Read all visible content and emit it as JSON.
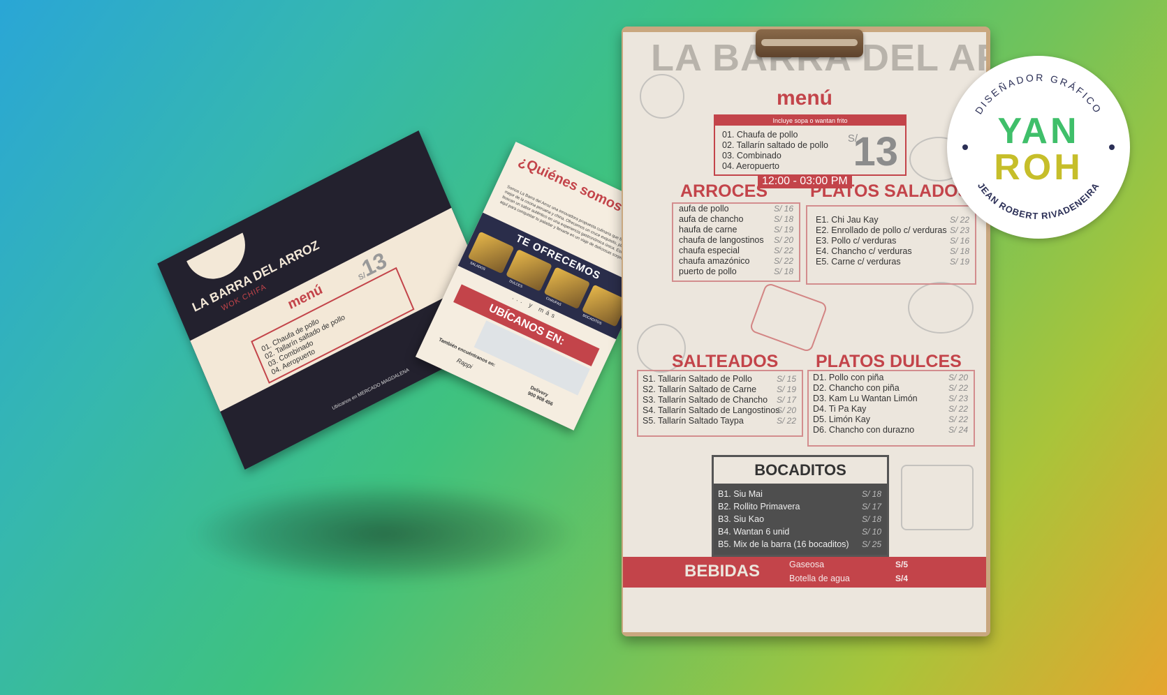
{
  "badge": {
    "top_text": "DISEÑADOR GRÁFICO",
    "bottom_text": "JEAN ROBERT RIVADENEIRA",
    "line1": "YAN",
    "line2": "ROH"
  },
  "menu_board": {
    "title": "LA BARRA DEL ARROZ",
    "menu_label": "menú",
    "combo": {
      "note": "Incluye sopa o wantan frito",
      "items": [
        "01. Chaufa de pollo",
        "02. Tallarín saltado de pollo",
        "03. Combinado",
        "04. Aeropuerto"
      ],
      "currency": "S/",
      "price": "13",
      "hours": "12:00 - 03:00 PM"
    },
    "arroces": {
      "title": "ARROCES",
      "items": [
        {
          "name": "aufa de pollo",
          "price": "S/ 16"
        },
        {
          "name": "aufa de chancho",
          "price": "S/ 18"
        },
        {
          "name": "haufa de carne",
          "price": "S/ 19"
        },
        {
          "name": "chaufa de langostinos",
          "price": "S/ 20"
        },
        {
          "name": "chaufa especial",
          "price": "S/ 22"
        },
        {
          "name": "chaufa amazónico",
          "price": "S/ 22"
        },
        {
          "name": "puerto de pollo",
          "price": "S/ 18"
        }
      ]
    },
    "platos_salados": {
      "title": "PLATOS SALADOS",
      "items": [
        {
          "name": "E1. Chi Jau Kay",
          "price": "S/ 22"
        },
        {
          "name": "E2. Enrollado de pollo c/ verduras",
          "price": "S/ 23"
        },
        {
          "name": "E3. Pollo c/ verduras",
          "price": "S/ 16"
        },
        {
          "name": "E4. Chancho c/ verduras",
          "price": "S/ 18"
        },
        {
          "name": "E5. Carne c/ verduras",
          "price": "S/ 19"
        }
      ]
    },
    "salteados": {
      "title": "SALTEADOS",
      "items": [
        {
          "name": "S1. Tallarín Saltado de Pollo",
          "price": "S/ 15"
        },
        {
          "name": "S2. Tallarín Saltado de Carne",
          "price": "S/ 19"
        },
        {
          "name": "S3. Tallarín Saltado de Chancho",
          "price": "S/ 17"
        },
        {
          "name": "S4. Tallarín Saltado de Langostinos",
          "price": "S/ 20"
        },
        {
          "name": "S5. Tallarín Saltado Taypa",
          "price": "S/ 22"
        }
      ]
    },
    "platos_dulces": {
      "title": "PLATOS DULCES",
      "items": [
        {
          "name": "D1. Pollo con piña",
          "price": "S/ 20"
        },
        {
          "name": "D2. Chancho con piña",
          "price": "S/ 22"
        },
        {
          "name": "D3. Kam Lu Wantan Limón",
          "price": "S/ 23"
        },
        {
          "name": "D4. Ti Pa Kay",
          "price": "S/ 22"
        },
        {
          "name": "D5. Limón Kay",
          "price": "S/ 22"
        },
        {
          "name": "D6. Chancho con durazno",
          "price": "S/ 24"
        }
      ]
    },
    "bocaditos": {
      "title": "BOCADITOS",
      "items": [
        {
          "name": "B1. Siu Mai",
          "price": "S/ 18"
        },
        {
          "name": "B2. Rollito Primavera",
          "price": "S/ 17"
        },
        {
          "name": "B3. Siu Kao",
          "price": "S/ 18"
        },
        {
          "name": "B4. Wantan 6 unid",
          "price": "S/ 10"
        },
        {
          "name": "B5. Mix de la barra (16 bocaditos)",
          "price": "S/ 25"
        }
      ]
    },
    "bebidas": {
      "title": "BEBIDAS",
      "items": [
        {
          "name": "Gaseosa",
          "price": "S/5"
        },
        {
          "name": "Botella de agua",
          "price": "S/4"
        }
      ]
    }
  },
  "flyer_front": {
    "brand": "LA BARRA DEL ARROZ",
    "subtitle": "WOK CHIFA",
    "menu_label": "menú",
    "currency": "S/",
    "price": "13",
    "items": [
      "01. Chaufa de pollo",
      "02. Tallarín saltado de pollo",
      "03. Combinado",
      "04. Aeropuerto"
    ],
    "footer": "Ubícanos en MERCADO MAGDALENA"
  },
  "flyer_back": {
    "heading": "¿Quiénes somos?",
    "paragraph": "Somos La Barra del Arroz una innovadora propuesta culinaria que fusiona lo mejor de la cocina peruana y china. Ofrecemos un cruce exquisito, platos que buscan un sabor auténtico en una experiencia gastronómica única. Estamos aquí para conquistar tu paladar y llevarte en un viaje de deliciosas sorpresas.",
    "offer_title": "TE OFRECEMOS",
    "offer_labels": [
      "SALADOS",
      "DULCES",
      "CHAUFAS",
      "BOCADITOS"
    ],
    "y_mas": "... y más",
    "ubicanos": "UBÍCANOS EN:",
    "tambien": "También encuéntranos en:",
    "app": "Rappi",
    "delivery_label": "Delivery",
    "delivery_phone": "900 908 456"
  },
  "colors": {
    "accent_red": "#c3444a",
    "navy": "#23212e",
    "cream": "#ece6dd",
    "badge_green": "#3fbf6a",
    "badge_olive": "#c6be2a"
  }
}
